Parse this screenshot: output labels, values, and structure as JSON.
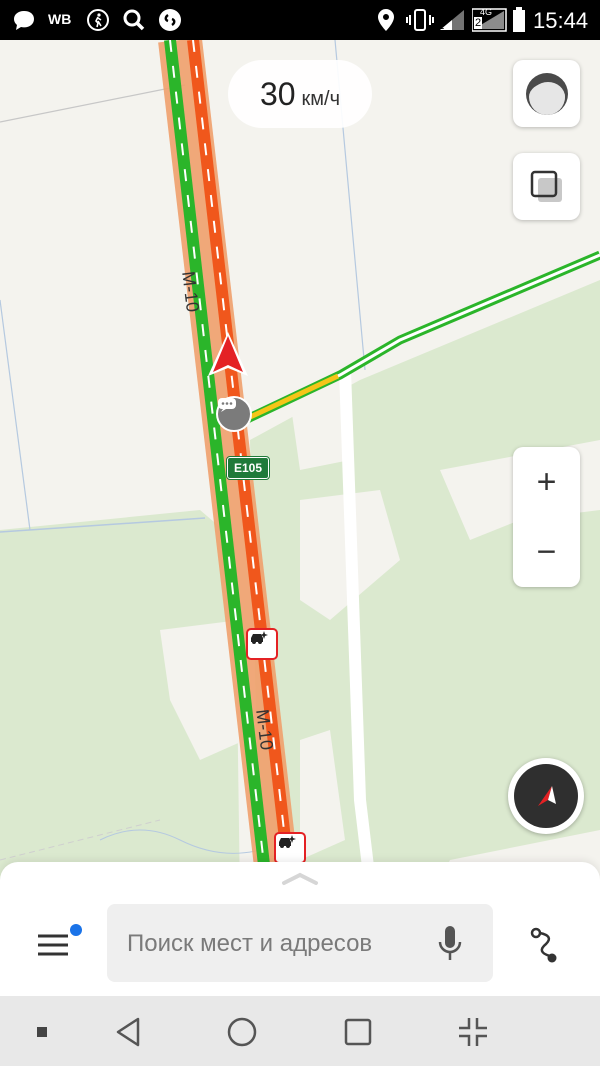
{
  "status_bar": {
    "carrier": "WB",
    "network_type": "4G",
    "sim_slot": "2",
    "time": "15:44",
    "icons": [
      "message-icon",
      "wb-icon",
      "walking-icon",
      "search-icon",
      "shazam-icon",
      "location-icon",
      "vibrate-icon",
      "signal-icon",
      "signal-4g-icon",
      "battery-icon"
    ]
  },
  "map": {
    "speed": {
      "value": "30",
      "unit": "км/ч"
    },
    "road_labels": {
      "route_top": "М-10",
      "route_bottom": "М-10",
      "shield": "E105"
    },
    "colors": {
      "jam_red": "#f0571c",
      "free_green": "#2bb52a",
      "slow_yellow": "#f5c518",
      "land": "#f4f3ee",
      "forest": "#dbe9cf",
      "shield_green": "#1f7a3a",
      "user_arrow": "#e42124"
    }
  },
  "controls": {
    "layers_icon": "layers-icon",
    "traffic_icon": "traffic-toggle-icon",
    "zoom_in": "+",
    "zoom_out": "−",
    "compass_icon": "compass-icon"
  },
  "bottom_sheet": {
    "search_placeholder": "Поиск мест и адресов",
    "menu_icon": "menu-icon",
    "mic_icon": "microphone-icon",
    "route_icon": "route-icon",
    "notification_color": "#1a73e8"
  },
  "nav_bar": {
    "buttons": [
      "square-small-icon",
      "back-icon",
      "home-icon",
      "recents-icon",
      "collapse-icon"
    ]
  }
}
